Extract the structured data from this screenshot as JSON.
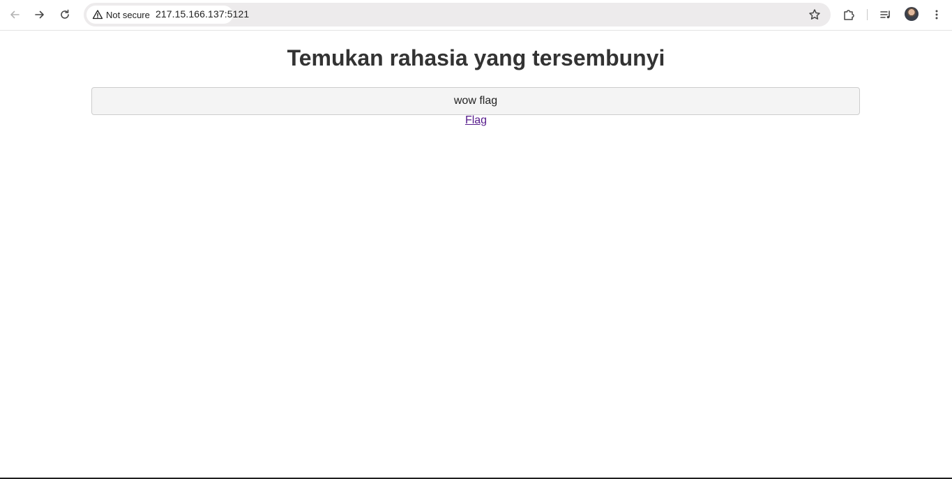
{
  "browser": {
    "security_label": "Not secure",
    "url": "217.15.166.137:5121",
    "icons": {
      "back": "arrow-left-icon",
      "forward": "arrow-right-icon",
      "reload": "reload-icon",
      "security": "warning-triangle-icon",
      "bookmark": "star-icon",
      "extensions": "puzzle-icon",
      "media": "media-queue-icon",
      "profile": "avatar",
      "menu": "kebab-menu-icon"
    }
  },
  "page": {
    "title": "Temukan rahasia yang tersembunyi",
    "input_value": "wow flag",
    "link_label": "Flag"
  },
  "colors": {
    "heading": "#333333",
    "link_visited": "#551a8b",
    "omnibox_bg": "#edebec"
  }
}
